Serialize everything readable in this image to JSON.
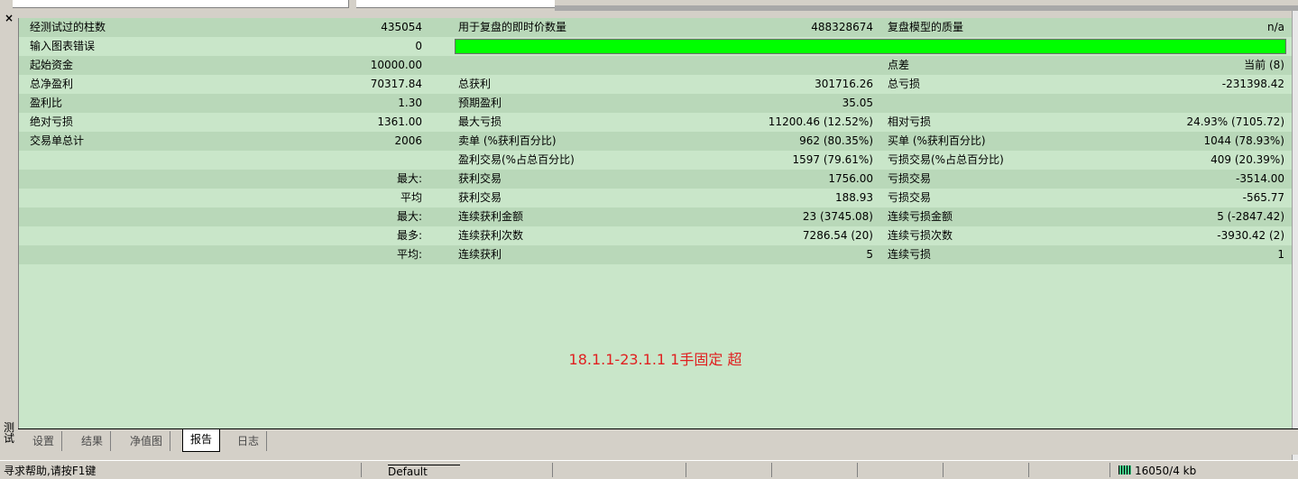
{
  "window": {
    "close_glyph": "×",
    "side_label": "测试"
  },
  "rows": [
    {
      "style": "dark",
      "c1": "经测试过的柱数",
      "v1": "435054",
      "c2": "用于复盘的即时价数量",
      "v2": "488328674",
      "c3": "复盘模型的质量",
      "v3": "n/a"
    },
    {
      "style": "light",
      "c1": "输入图表错误",
      "v1": "0",
      "c2": "",
      "v2": "",
      "c3": "",
      "v3": "",
      "bar": true
    },
    {
      "style": "dark",
      "c1": "起始资金",
      "v1": "10000.00",
      "c2": "",
      "v2": "",
      "c3": "点差",
      "v3": "当前 (8)"
    },
    {
      "style": "light",
      "c1": "总净盈利",
      "v1": "70317.84",
      "c2": "总获利",
      "v2": "301716.26",
      "c3": "总亏损",
      "v3": "-231398.42"
    },
    {
      "style": "dark",
      "c1": "盈利比",
      "v1": "1.30",
      "c2": "预期盈利",
      "v2": "35.05",
      "c3": "",
      "v3": ""
    },
    {
      "style": "light",
      "c1": "绝对亏损",
      "v1": "1361.00",
      "c2": "最大亏损",
      "v2": "11200.46 (12.52%)",
      "c3": "相对亏损",
      "v3": "24.93% (7105.72)"
    },
    {
      "style": "dark",
      "c1": "交易单总计",
      "v1": "2006",
      "c2": "卖单 (%获利百分比)",
      "v2": "962 (80.35%)",
      "c3": "买单 (%获利百分比)",
      "v3": "1044 (78.93%)"
    },
    {
      "style": "light",
      "c1": "",
      "v1": "",
      "c2": "盈利交易(%占总百分比)",
      "v2": "1597 (79.61%)",
      "c3": "亏损交易(%占总百分比)",
      "v3": "409 (20.39%)"
    },
    {
      "style": "dark",
      "c1": "",
      "v1": "最大:",
      "c2": "获利交易",
      "v2": "1756.00",
      "c3": "亏损交易",
      "v3": "-3514.00"
    },
    {
      "style": "light",
      "c1": "",
      "v1": "平均",
      "c2": "获利交易",
      "v2": "188.93",
      "c3": "亏损交易",
      "v3": "-565.77"
    },
    {
      "style": "dark",
      "c1": "",
      "v1": "最大:",
      "c2": "连续获利金额",
      "v2": "23 (3745.08)",
      "c3": "连续亏损金额",
      "v3": "5 (-2847.42)"
    },
    {
      "style": "light",
      "c1": "",
      "v1": "最多:",
      "c2": "连续获利次数",
      "v2": "7286.54 (20)",
      "c3": "连续亏损次数",
      "v3": "-3930.42 (2)"
    },
    {
      "style": "dark",
      "c1": "",
      "v1": "平均:",
      "c2": "连续获利",
      "v2": "5",
      "c3": "连续亏损",
      "v3": "1"
    }
  ],
  "colors": {
    "bar": "#00ff00",
    "note": "#e02020",
    "row_dark": "#b9d8b9",
    "row_light": "#c9e6c9"
  },
  "note": "18.1.1-23.1.1   1手固定  超",
  "tabs": [
    {
      "label": "设置",
      "name": "tab-settings",
      "active": false
    },
    {
      "label": "结果",
      "name": "tab-results",
      "active": false
    },
    {
      "label": "净值图",
      "name": "tab-equity-chart",
      "active": false
    },
    {
      "label": "报告",
      "name": "tab-report",
      "active": true
    },
    {
      "label": "日志",
      "name": "tab-journal",
      "active": false
    }
  ],
  "status": {
    "help": "寻求帮助,请按F1键",
    "profile": "Default",
    "traffic": "16050/4 kb",
    "meter_icon": "connection-meter-icon"
  }
}
